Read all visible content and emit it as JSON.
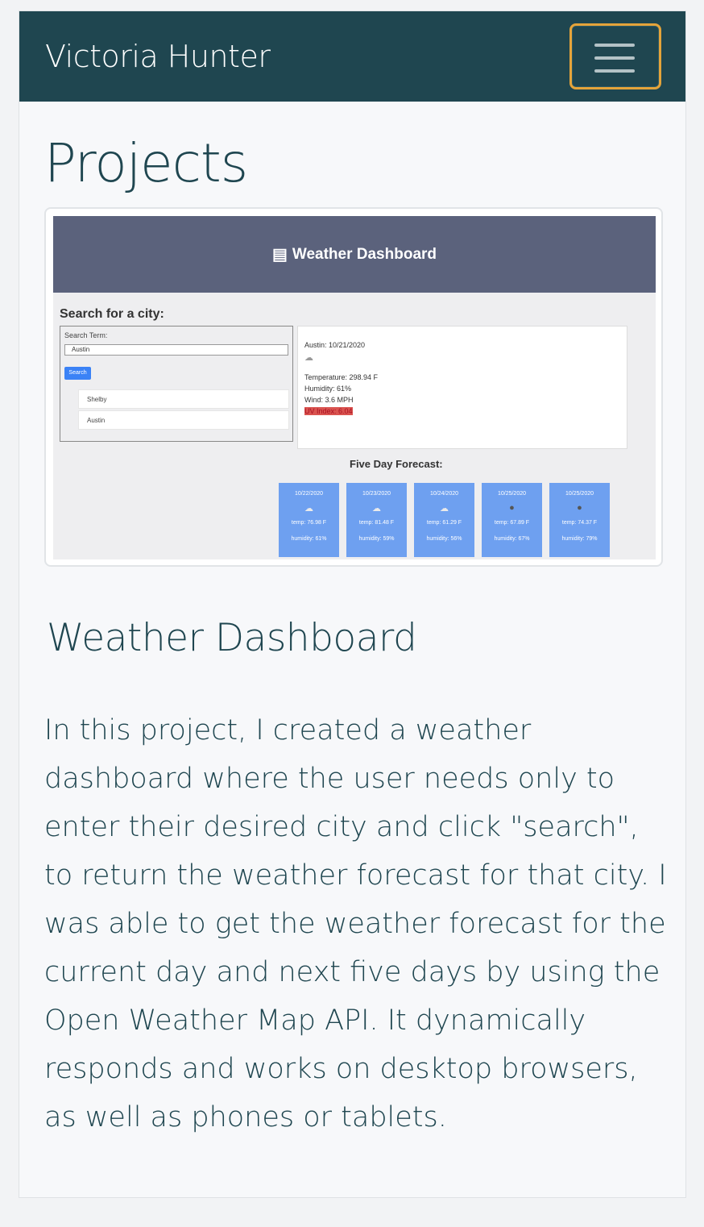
{
  "navbar": {
    "brand": "Victoria Hunter",
    "toggle_icon": "hamburger-menu-icon",
    "toggle_border_color": "#e5a43a",
    "background": "#1f4650"
  },
  "main": {
    "title": "Projects",
    "project": {
      "name": "Weather Dashboard",
      "description": "In this project, I created a weather dashboard where the user needs only to enter their desired city and click \"search\", to return the weather forecast for that city. I was able to get the weather forecast for the current day and next five days by using the Open Weather Map API. It dynamically responds and works on desktop browsers, as well as phones or tablets.",
      "screenshot": {
        "header_icon": "newspaper-icon",
        "header_title": "Weather Dashboard",
        "search_title": "Search for a city:",
        "search_term_label": "Search Term:",
        "search_value": "Austin",
        "search_button": "Search",
        "history": [
          "Shelby",
          "Austin"
        ],
        "current": {
          "city_date": "Austin: 10/21/2020",
          "weather_icon": "cloud-sun-icon",
          "temperature": "Temperature: 298.94 F",
          "humidity": "Humidity: 61%",
          "wind": "Wind: 3.6 MPH",
          "uv": "UV Index: 6.04"
        },
        "five_day_title": "Five Day Forecast:",
        "forecast": [
          {
            "date": "10/22/2020",
            "icon": "cloud-sun-icon",
            "temp": "temp: 76.98 F",
            "humidity": "humidity: 61%"
          },
          {
            "date": "10/23/2020",
            "icon": "cloud-sun-icon",
            "temp": "temp: 81.48 F",
            "humidity": "humidity: 59%"
          },
          {
            "date": "10/24/2020",
            "icon": "cloud-icon",
            "temp": "temp: 61.29 F",
            "humidity": "humidity: 56%"
          },
          {
            "date": "10/25/2020",
            "icon": "rain-cloud-icon",
            "temp": "temp: 67.89 F",
            "humidity": "humidity: 67%"
          },
          {
            "date": "10/25/2020",
            "icon": "rain-cloud-icon",
            "temp": "temp: 74.37 F",
            "humidity": "humidity: 79%"
          }
        ]
      }
    }
  }
}
